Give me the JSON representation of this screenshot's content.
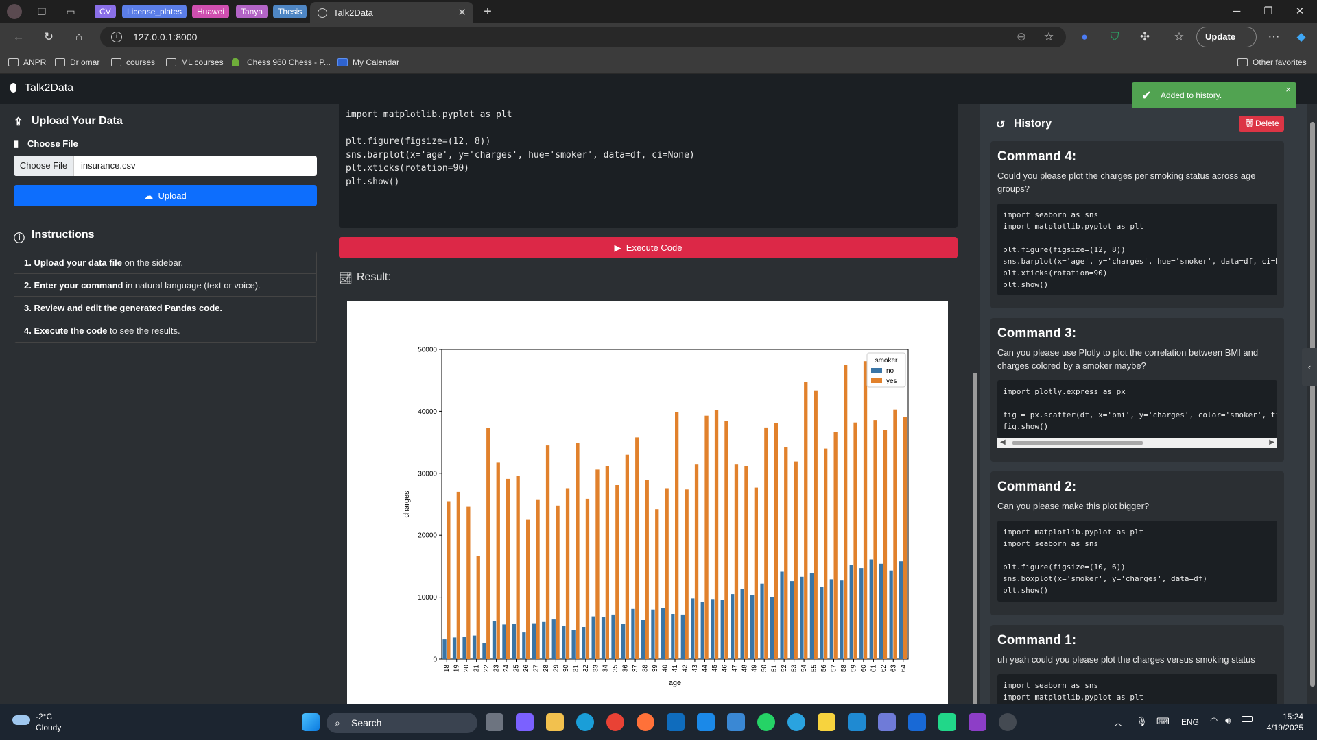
{
  "browser": {
    "tab_groups": [
      {
        "label": "CV",
        "color": "#8a6fe8"
      },
      {
        "label": "License_plates",
        "color": "#5b7ee8"
      },
      {
        "label": "Huawei",
        "color": "#d04fb0"
      },
      {
        "label": "Tanya",
        "color": "#b364c6"
      },
      {
        "label": "Thesis",
        "color": "#4e86c4"
      }
    ],
    "active_tab_title": "Talk2Data",
    "url": "127.0.0.1:8000",
    "update_label": "Update",
    "bookmarks": [
      "ANPR",
      "Dr omar",
      "courses",
      "ML courses",
      "Chess 960 Chess - P...",
      "My Calendar"
    ],
    "other_favorites": "Other favorites"
  },
  "app": {
    "title": "Talk2Data",
    "sidebar": {
      "upload_heading": "Upload Your Data",
      "choose_file_label": "Choose File",
      "file_button": "Choose File",
      "file_name": "insurance.csv",
      "upload_button": "Upload",
      "instructions_heading": "Instructions",
      "steps": [
        {
          "bold": "1. Upload your data file",
          "rest": " on the sidebar."
        },
        {
          "bold": "2. Enter your command",
          "rest": " in natural language (text or voice)."
        },
        {
          "bold": "3. Review and edit the generated Pandas code.",
          "rest": ""
        },
        {
          "bold": "4. Execute the code",
          "rest": " to see the results."
        }
      ]
    },
    "main": {
      "code": "import matplotlib.pyplot as plt\n\nplt.figure(figsize=(12, 8))\nsns.barplot(x='age', y='charges', hue='smoker', data=df, ci=None)\nplt.xticks(rotation=90)\nplt.show()",
      "execute_button": "Execute Code",
      "result_heading": "Result:"
    },
    "history": {
      "title": "History",
      "delete_button": "Delete",
      "items": [
        {
          "title": "Command 4:",
          "text": "Could you please plot the charges per smoking status across age groups?",
          "code": "import seaborn as sns\nimport matplotlib.pyplot as plt\n\nplt.figure(figsize=(12, 8))\nsns.barplot(x='age', y='charges', hue='smoker', data=df, ci=None\nplt.xticks(rotation=90)\nplt.show()"
        },
        {
          "title": "Command 3:",
          "text": "Can you please use Plotly to plot the correlation between BMI and charges colored by a smoker maybe?",
          "code": "import plotly.express as px\n\nfig = px.scatter(df, x='bmi', y='charges', color='smoker', title\nfig.show()"
        },
        {
          "title": "Command 2:",
          "text": "Can you please make this plot bigger?",
          "code": "import matplotlib.pyplot as plt\nimport seaborn as sns\n\nplt.figure(figsize=(10, 6))\nsns.boxplot(x='smoker', y='charges', data=df)\nplt.show()"
        },
        {
          "title": "Command 1:",
          "text": "uh yeah could you please plot the charges versus smoking status",
          "code": "import seaborn as sns\nimport matplotlib.pyplot as plt"
        }
      ]
    },
    "toast": "Added to history."
  },
  "chart_data": {
    "type": "bar",
    "xlabel": "age",
    "ylabel": "charges",
    "ylim": [
      0,
      50000
    ],
    "yticks": [
      0,
      10000,
      20000,
      30000,
      40000,
      50000
    ],
    "legend_title": "smoker",
    "legend_position": "top-right",
    "categories": [
      "18",
      "19",
      "20",
      "21",
      "22",
      "23",
      "24",
      "25",
      "26",
      "27",
      "28",
      "29",
      "30",
      "31",
      "32",
      "33",
      "34",
      "35",
      "36",
      "37",
      "38",
      "39",
      "40",
      "41",
      "42",
      "43",
      "44",
      "45",
      "46",
      "47",
      "48",
      "49",
      "50",
      "51",
      "52",
      "53",
      "54",
      "55",
      "56",
      "57",
      "58",
      "59",
      "60",
      "61",
      "62",
      "63",
      "64"
    ],
    "series": [
      {
        "name": "no",
        "color": "#3a75a6",
        "values": [
          3200,
          3500,
          3600,
          3800,
          2600,
          6100,
          5600,
          5700,
          4300,
          5800,
          6000,
          6400,
          5400,
          4700,
          5200,
          6900,
          6800,
          7200,
          5700,
          8100,
          6300,
          8000,
          8200,
          7300,
          7200,
          9800,
          9200,
          9700,
          9600,
          10500,
          11300,
          10300,
          12200,
          10000,
          14100,
          12600,
          13300,
          13900,
          11700,
          12900,
          12700,
          15200,
          14700,
          16100,
          15400,
          14300,
          15800
        ]
      },
      {
        "name": "yes",
        "color": "#e1812c",
        "values": [
          25500,
          27000,
          24600,
          16600,
          37300,
          31700,
          29100,
          29600,
          22500,
          25700,
          34500,
          24800,
          27600,
          34900,
          25900,
          30600,
          31200,
          28100,
          33000,
          35800,
          28900,
          24200,
          27600,
          39900,
          27400,
          31500,
          39300,
          40200,
          38500,
          31500,
          31200,
          27700,
          37400,
          38100,
          34200,
          31900,
          44700,
          43400,
          34000,
          36700,
          47500,
          38200,
          48100,
          38600,
          37000,
          40300,
          39100
        ]
      }
    ]
  },
  "taskbar": {
    "temperature": "-2°C",
    "condition": "Cloudy",
    "search_label": "Search",
    "lang": "ENG",
    "time": "15:24",
    "date": "4/19/2025"
  }
}
